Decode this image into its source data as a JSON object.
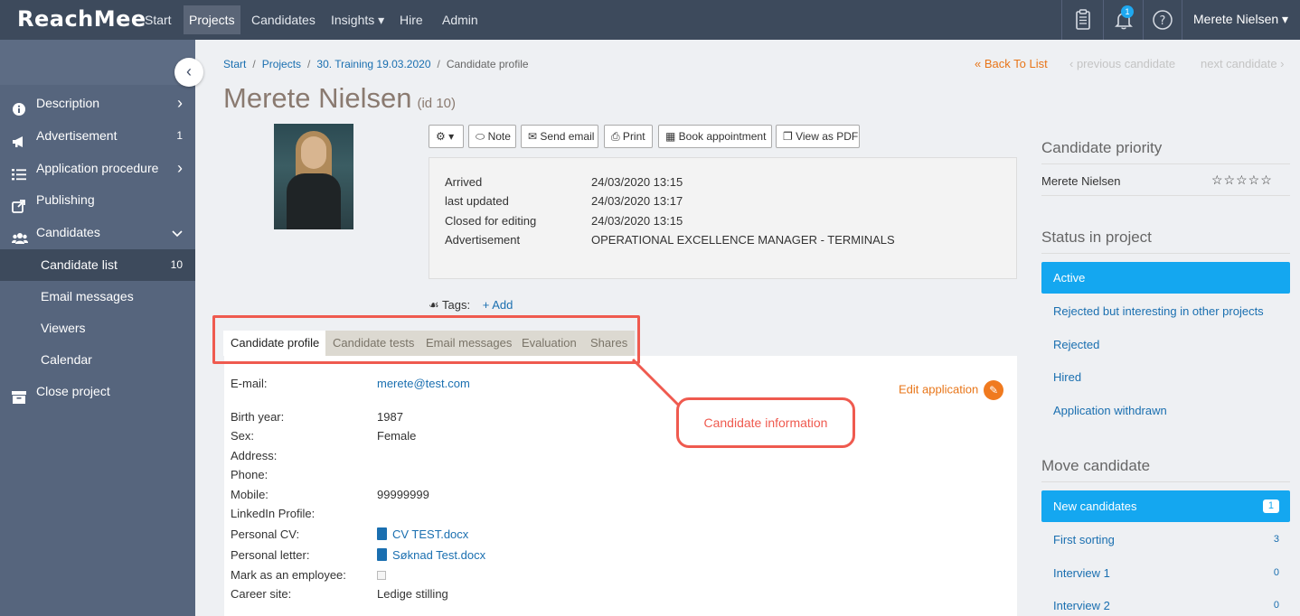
{
  "app": {
    "logo": "ReachMee"
  },
  "topnav": {
    "items": [
      "Start",
      "Projects",
      "Candidates",
      "Insights ▾",
      "Hire",
      "Admin"
    ],
    "notifications_count": "1",
    "user": "Merete Nielsen ▾"
  },
  "sidebar": {
    "items": [
      {
        "label": "Description",
        "right": "›"
      },
      {
        "label": "Advertisement",
        "right": "1"
      },
      {
        "label": "Application procedure",
        "right": "›"
      },
      {
        "label": "Publishing",
        "right": ""
      },
      {
        "label": "Candidates",
        "right": "⌄"
      }
    ],
    "subitems": [
      {
        "label": "Candidate list",
        "right": "10"
      },
      {
        "label": "Email messages",
        "right": ""
      },
      {
        "label": "Viewers",
        "right": ""
      },
      {
        "label": "Calendar",
        "right": ""
      }
    ],
    "close_project": "Close project"
  },
  "breadcrumb": [
    "Start",
    "Projects",
    "30. Training 19.03.2020",
    "Candidate profile"
  ],
  "pager": {
    "back": "« Back To List",
    "prev": "‹ previous candidate",
    "next": "next candidate ›"
  },
  "candidate": {
    "name": "Merete Nielsen",
    "id_label": "(id 10)"
  },
  "toolbar": {
    "gear": "⚙ ▾",
    "note": "⬭ Note",
    "send_email": "✉ Send email",
    "print": "⎙ Print",
    "book": "▦ Book appointment",
    "pdf": "❐ View as PDF"
  },
  "info": [
    {
      "label": "Arrived",
      "value": "24/03/2020 13:15"
    },
    {
      "label": "last updated",
      "value": "24/03/2020 13:17"
    },
    {
      "label": "Closed for editing",
      "value": "24/03/2020 13:15"
    },
    {
      "label": "Advertisement",
      "value": "OPERATIONAL EXCELLENCE MANAGER - TERMINALS"
    }
  ],
  "tags": {
    "label": "Tags:",
    "add": "+ Add"
  },
  "tabs": [
    "Candidate profile",
    "Candidate tests",
    "Email messages",
    "Evaluation",
    "Shares"
  ],
  "profile": {
    "email_label": "E-mail:",
    "email": "merete@test.com",
    "edit_application": "Edit application",
    "fields": [
      {
        "label": "Birth year:",
        "value": "1987"
      },
      {
        "label": "Sex:",
        "value": "Female"
      },
      {
        "label": "Address:",
        "value": ""
      },
      {
        "label": "Phone:",
        "value": ""
      },
      {
        "label": "Mobile:",
        "value": "99999999"
      },
      {
        "label": "LinkedIn Profile:",
        "value": ""
      },
      {
        "label": "Personal CV:",
        "value": "CV TEST.docx"
      },
      {
        "label": "Personal letter:",
        "value": "Søknad Test.docx"
      },
      {
        "label": "Mark as an employee:",
        "value": ""
      },
      {
        "label": "Career site:",
        "value": "Ledige stilling"
      }
    ]
  },
  "annotation": {
    "callout": "Candidate information"
  },
  "right": {
    "priority_title": "Candidate priority",
    "priority_name": "Merete Nielsen",
    "stars": "☆☆☆☆☆",
    "status_title": "Status in project",
    "statuses": [
      "Active",
      "Rejected but interesting in other projects",
      "Rejected",
      "Hired",
      "Application withdrawn"
    ],
    "move_title": "Move candidate",
    "moves": [
      {
        "label": "New candidates",
        "count": "1"
      },
      {
        "label": "First sorting",
        "count": "3"
      },
      {
        "label": "Interview 1",
        "count": "0"
      },
      {
        "label": "Interview 2",
        "count": "0"
      }
    ]
  },
  "colors": {
    "nav_bg": "#3d4a5c",
    "sidebar_bg": "#56657d",
    "accent_blue": "#14a7f0",
    "annotation_red": "#ef5a4f",
    "orange": "#e87518"
  }
}
